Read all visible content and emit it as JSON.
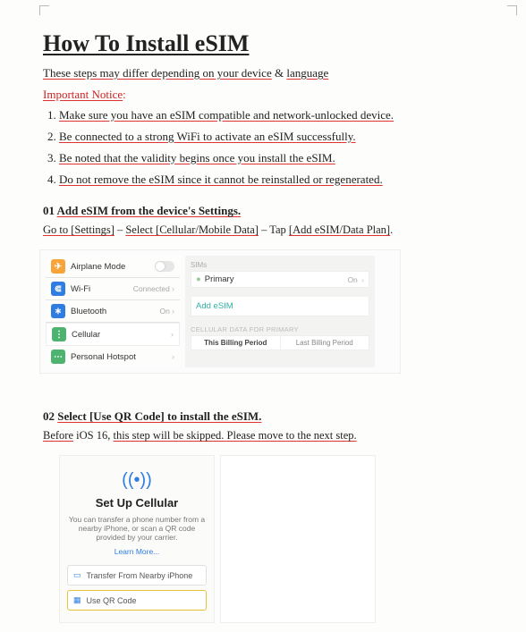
{
  "title": "How To Install eSIM",
  "intro": {
    "pre": "These steps may differ depending on your device",
    "amp": " & ",
    "post": "language"
  },
  "important": "Important Notice",
  "notes": [
    "Make sure you have an eSIM compatible and network-unlocked device.",
    "Be connected to a strong WiFi to activate an eSIM successfully.",
    "Be noted that the validity begins once you install the eSIM.",
    "Do not remove the eSIM since it cannot be reinstalled or regenerated."
  ],
  "step1": {
    "num": "01 ",
    "head": "Add eSIM from the device's Settings.",
    "sub_parts": [
      "Go to ",
      "[Settings]",
      " – ",
      "Select ",
      "[Cellular/",
      "Mobile Data]",
      " – Tap ",
      "[Add eSIM/",
      "Data Plan]",
      "."
    ]
  },
  "settings": {
    "rows": [
      {
        "label": "Airplane Mode",
        "icon_bg": "#f7a43b",
        "glyph": "✈",
        "right": "toggle"
      },
      {
        "label": "Wi-Fi",
        "icon_bg": "#2f7de1",
        "glyph": "⌔",
        "right": "Connected"
      },
      {
        "label": "Bluetooth",
        "icon_bg": "#2f7de1",
        "glyph": "∗",
        "right": "On"
      },
      {
        "label": "Cellular",
        "icon_bg": "#4db36f",
        "glyph": "⋮",
        "right": ""
      },
      {
        "label": "Personal Hotspot",
        "icon_bg": "#4db36f",
        "glyph": "⋯",
        "right": ""
      }
    ],
    "right": {
      "top": "SIMs",
      "primary": "Primary",
      "on": "On",
      "add": "Add eSIM",
      "cd": "CELLULAR DATA FOR PRIMARY",
      "p1": "This Billing Period",
      "p2": "Last Billing Period"
    }
  },
  "step2": {
    "num": "02 ",
    "head": "Select [Use QR Code] to install the eSIM.",
    "sub_parts": [
      "Before",
      " iOS 16, ",
      "this step will be skipped. ",
      "Please move to the next step."
    ]
  },
  "phone": {
    "title": "Set Up Cellular",
    "desc": "You can transfer a phone number from a nearby iPhone, or scan a QR code provided by your carrier.",
    "learn": "Learn More...",
    "opt1": "Transfer From Nearby iPhone",
    "opt2": "Use QR Code"
  }
}
